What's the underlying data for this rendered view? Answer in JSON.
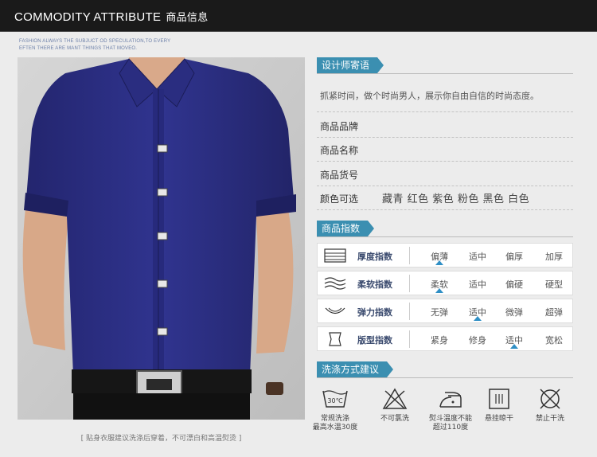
{
  "header": {
    "title": "COMMODITY ATTRIBUTE",
    "title_cn": "商品信息"
  },
  "slogan": {
    "line1": "FASHION ALWAYS THE  SUBJUCT OD SPECULATION,TO EVERY",
    "line2": "EFTEN THERE ARE MANT THINGS THAT MOVEO."
  },
  "photo": {
    "caption": "[  贴身衣服建议洗涤后穿着，不可漂白和高温熨烫  ]"
  },
  "designer": {
    "heading": "设计师寄语",
    "text": "抓紧时间，做个时尚男人，展示你自由自信的时尚态度。"
  },
  "product": {
    "brand_label": "商品品牌",
    "name_label": "商品名称",
    "sku_label": "商品货号",
    "color_label": "颜色可选",
    "colors": "藏青 红色 紫色 粉色 黑色 白色"
  },
  "index": {
    "heading": "商品指数",
    "rows": [
      {
        "label": "厚度指数",
        "icon": "layers-icon",
        "options": [
          "偏薄",
          "适中",
          "偏厚",
          "加厚"
        ],
        "selected": 0
      },
      {
        "label": "柔软指数",
        "icon": "waves-icon",
        "options": [
          "柔软",
          "适中",
          "偏硬",
          "硬型"
        ],
        "selected": 0
      },
      {
        "label": "弹力指数",
        "icon": "stretch-icon",
        "options": [
          "无弹",
          "适中",
          "微弹",
          "超弹"
        ],
        "selected": 1
      },
      {
        "label": "版型指数",
        "icon": "shirt-fit-icon",
        "options": [
          "紧身",
          "修身",
          "适中",
          "宽松"
        ],
        "selected": 2
      }
    ]
  },
  "wash": {
    "heading": "洗涤方式建议",
    "items": [
      {
        "icon": "wash-30-icon",
        "symbol": "30℃",
        "line1": "常规洗涤",
        "line2": "最高水温30度"
      },
      {
        "icon": "no-bleach-icon",
        "line1": "不可氯洗",
        "line2": ""
      },
      {
        "icon": "iron-icon",
        "line1": "熨斗温度不能",
        "line2": "超过110度"
      },
      {
        "icon": "hang-dry-icon",
        "line1": "悬挂晾干",
        "line2": ""
      },
      {
        "icon": "no-dry-clean-icon",
        "line1": "禁止干洗",
        "line2": ""
      }
    ]
  },
  "colors": {
    "accent": "#3b8fb1",
    "marker": "#2f8fc5",
    "header_bg": "#1a1a1a",
    "shirt": "#2b2e86"
  }
}
